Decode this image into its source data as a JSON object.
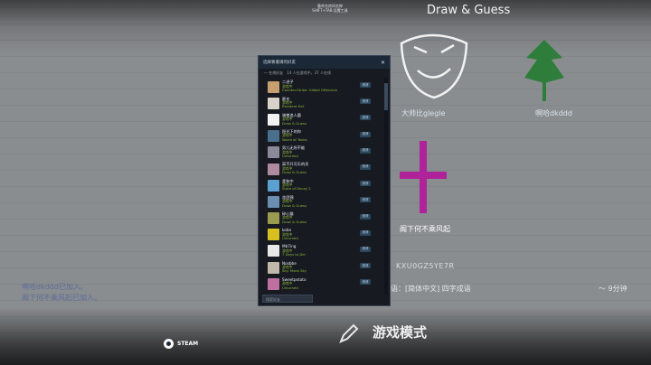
{
  "game": {
    "title": "Draw & Guess",
    "top_caption_1": "重命名房间名称",
    "top_caption_2": "SHIFT+TAB 设置工具"
  },
  "players": [
    {
      "name": "大帅比glegle"
    },
    {
      "name": "啊哈dkddd"
    }
  ],
  "guess_text": "阁下何不乘风起",
  "room_code": "KXU0GZ5YE7R",
  "language_label": "语：[简体中文] 四字成语",
  "timer": "～ 9分钟",
  "chat": [
    "啊哈dkddd已加入。",
    "阁下何不乘风起已加入。"
  ],
  "mode_label": "游戏模式",
  "steam_label": "STEAM",
  "dialog": {
    "title": "选择要邀请的好友",
    "subtitle": "一 在线好友　14 人在游戏中，37 人在线",
    "invite_label": "邀请",
    "search_placeholder": "搜索好友",
    "friends": [
      {
        "name": "二进子",
        "status": "游戏中",
        "game": "Counter-Strike: Global Offensive",
        "color": "#c8a070"
      },
      {
        "name": "匿名",
        "status": "游戏中",
        "game": "Resident Evil",
        "color": "#d9d2c8"
      },
      {
        "name": "骑猪追人鹿",
        "status": "游戏中",
        "game": "Draw & Guess",
        "color": "#f2f2f2"
      },
      {
        "name": "阳光下的你",
        "status": "游戏中",
        "game": "World of Tanks",
        "color": "#4a6f8a"
      },
      {
        "name": "男儿无所不能",
        "status": "游戏中",
        "game": "Unturned",
        "color": "#8a8a9a"
      },
      {
        "name": "离不开可乐的呆",
        "status": "游戏中",
        "game": "Draw & Guess",
        "color": "#b08aa0"
      },
      {
        "name": "柔和中",
        "status": "游戏中",
        "game": "State of Decay 2",
        "color": "#5aa0d0"
      },
      {
        "name": "花团锦",
        "status": "游戏中",
        "game": "Draw & Guess",
        "color": "#6a8fb0"
      },
      {
        "name": "碎心猫",
        "status": "游戏中",
        "game": "Draw & Guess",
        "color": "#9a9a50"
      },
      {
        "name": "kobo",
        "status": "游戏中",
        "game": "Unturned",
        "color": "#d8c020"
      },
      {
        "name": "Mb7ing",
        "status": "游戏中",
        "game": "7 Days to Die",
        "color": "#e8e8e8"
      },
      {
        "name": "Nosbbe",
        "status": "游戏中",
        "game": "Sky: Mans Sky",
        "color": "#c0b8a8"
      },
      {
        "name": "Sweetpotato",
        "status": "游戏中",
        "game": "Unturned",
        "color": "#c070a0"
      }
    ]
  }
}
